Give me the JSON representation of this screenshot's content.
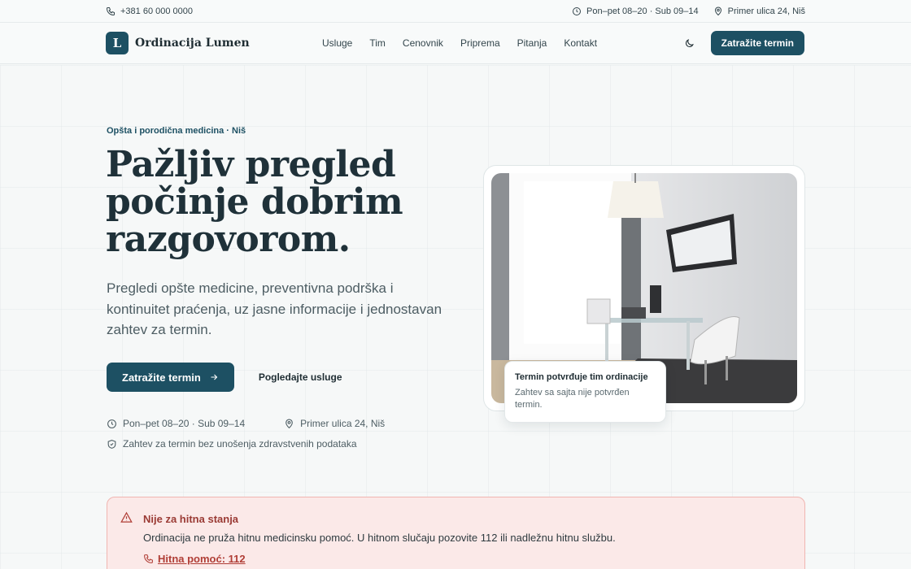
{
  "topbar": {
    "phone": "+381 60 000 0000",
    "hours": "Pon–pet 08–20 · Sub 09–14",
    "address": "Primer ulica 24, Niš"
  },
  "header": {
    "logo_letter": "L",
    "brand": "Ordinacija Lumen",
    "menu": [
      "Usluge",
      "Tim",
      "Cenovnik",
      "Priprema",
      "Pitanja",
      "Kontakt"
    ],
    "cta": "Zatražite termin"
  },
  "hero": {
    "eyebrow": "Opšta i porodična medicina · Niš",
    "title": "Pažljiv pregled počinje dobrim razgovorom.",
    "lead": "Pregledi opšte medicine, preventivna podrška i kontinuitet praćenja, uz jasne informacije i jednostavan zahtev za termin.",
    "primary_cta": "Zatražite termin",
    "secondary_cta": "Pogledajte usluge",
    "hours": "Pon–pet 08–20 · Sub 09–14",
    "address": "Primer ulica 24, Niš",
    "privacy": "Zahtev za termin bez unošenja zdravstvenih podataka"
  },
  "note": {
    "title": "Termin potvrđuje tim ordinacije",
    "text": "Zahtev sa sajta nije potvrđen termin."
  },
  "alert": {
    "title": "Nije za hitna stanja",
    "text": "Ordinacija ne pruža hitnu medicinsku pomoć. U hitnom slučaju pozovite 112 ili nadležnu hitnu službu.",
    "link": "Hitna pomoć: 112"
  },
  "colors": {
    "accent": "#1d5063",
    "alert_bg": "#fbe9e8",
    "alert_text": "#9a3a34"
  }
}
